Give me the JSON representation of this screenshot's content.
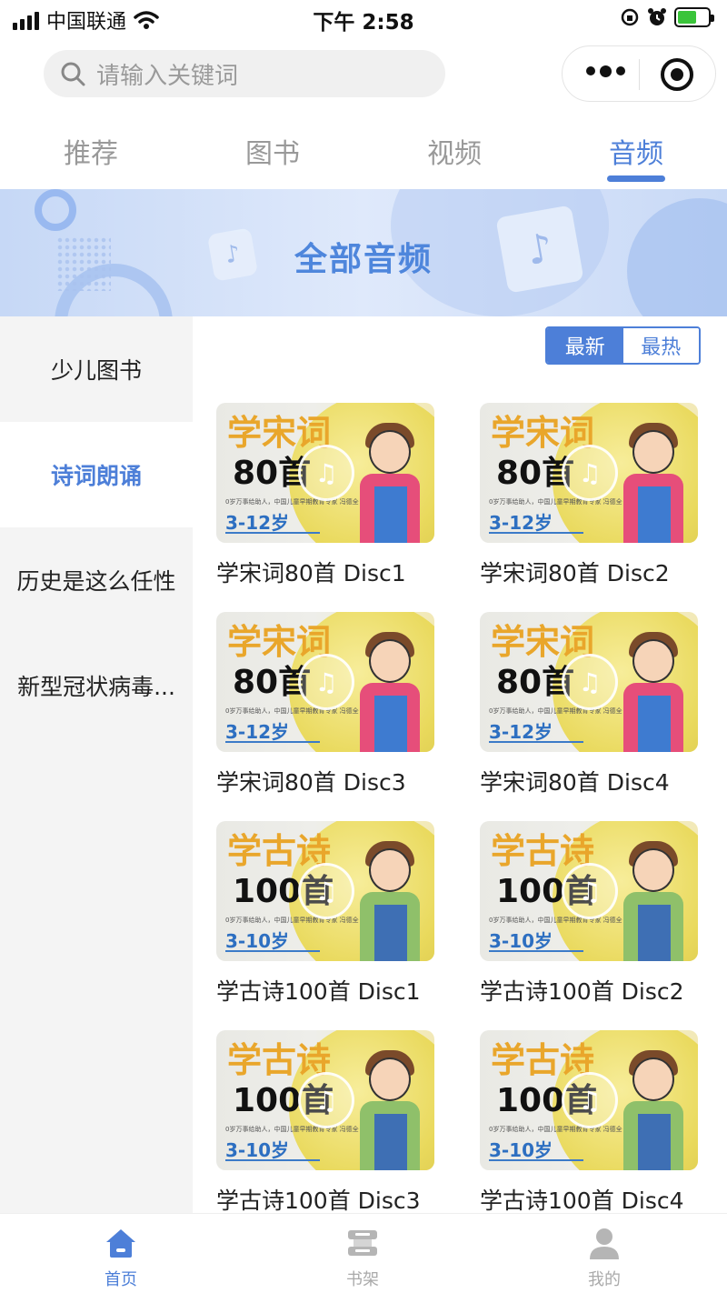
{
  "status_bar": {
    "carrier": "中国联通",
    "time": "下午 2:58"
  },
  "search": {
    "placeholder": "请输入关键词"
  },
  "tabs": [
    {
      "label": "推荐",
      "active": false
    },
    {
      "label": "图书",
      "active": false
    },
    {
      "label": "视频",
      "active": false
    },
    {
      "label": "音频",
      "active": true
    }
  ],
  "banner": {
    "title": "全部音频"
  },
  "sidebar": {
    "items": [
      {
        "label": "少儿图书",
        "active": false
      },
      {
        "label": "诗词朗诵",
        "active": true
      },
      {
        "label": "历史是这么任性",
        "active": false
      },
      {
        "label": "新型冠状病毒...",
        "active": false
      }
    ]
  },
  "sort": {
    "newest": "最新",
    "hottest": "最热",
    "active": "newest"
  },
  "covers": {
    "songci": {
      "line1": "学宋词",
      "line2": "80首",
      "age": "3-12岁"
    },
    "gushi": {
      "line1": "学古诗",
      "line2": "100首",
      "age": "3-10岁"
    },
    "fine_print": "0岁万事给助人，中国儿童早期教育专家 冯德全 教授主编"
  },
  "audio_items": [
    {
      "title": "学宋词80首 Disc1",
      "cover": "songci"
    },
    {
      "title": "学宋词80首 Disc2",
      "cover": "songci"
    },
    {
      "title": "学宋词80首 Disc3",
      "cover": "songci"
    },
    {
      "title": "学宋词80首 Disc4",
      "cover": "songci"
    },
    {
      "title": "学古诗100首 Disc1",
      "cover": "gushi"
    },
    {
      "title": "学古诗100首 Disc2",
      "cover": "gushi"
    },
    {
      "title": "学古诗100首 Disc3",
      "cover": "gushi"
    },
    {
      "title": "学古诗100首 Disc4",
      "cover": "gushi"
    }
  ],
  "bottom_nav": [
    {
      "label": "首页",
      "icon": "home-icon",
      "active": true
    },
    {
      "label": "书架",
      "icon": "bookshelf-icon",
      "active": false
    },
    {
      "label": "我的",
      "icon": "user-icon",
      "active": false
    }
  ],
  "colors": {
    "accent": "#4d7fd8",
    "banner_bg": "#c8d9f6",
    "sidebar_bg": "#f4f4f4"
  }
}
